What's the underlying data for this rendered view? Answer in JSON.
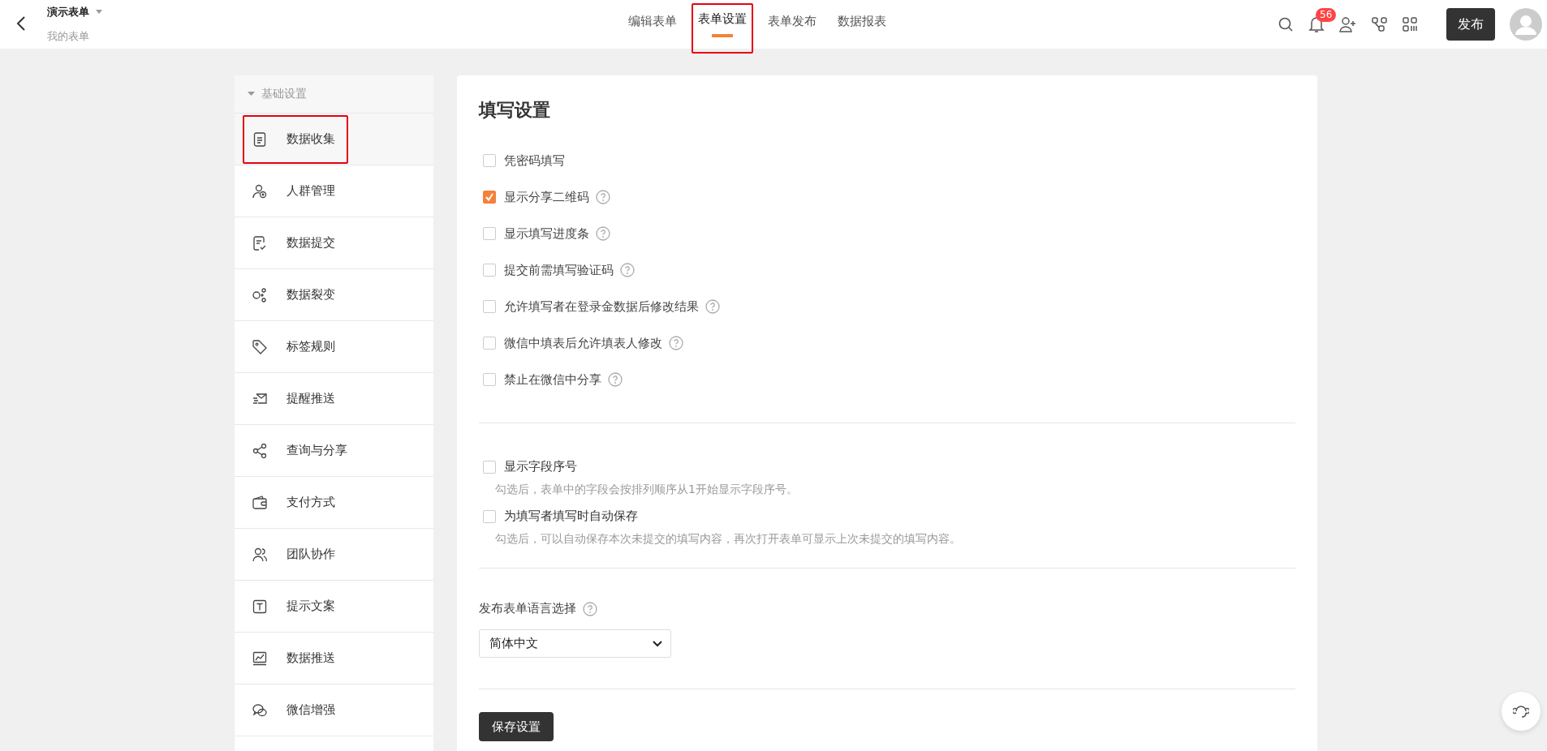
{
  "header": {
    "title": "演示表单",
    "subtitle": "我的表单",
    "notification_count": "56",
    "publish_button": "发布"
  },
  "tabs": [
    {
      "label": "编辑表单",
      "selected": false,
      "annotated": false
    },
    {
      "label": "表单设置",
      "selected": true,
      "annotated": true
    },
    {
      "label": "表单发布",
      "selected": false,
      "annotated": false
    },
    {
      "label": "数据报表",
      "selected": false,
      "annotated": false
    }
  ],
  "sidebar": {
    "section": "基础设置",
    "expanded": true,
    "items": [
      {
        "label": "数据收集",
        "selected": true,
        "annotated": true
      },
      {
        "label": "人群管理",
        "selected": false,
        "annotated": false
      },
      {
        "label": "数据提交",
        "selected": false,
        "annotated": false
      },
      {
        "label": "数据裂变",
        "selected": false,
        "annotated": false
      },
      {
        "label": "标签规则",
        "selected": false,
        "annotated": false
      },
      {
        "label": "提醒推送",
        "selected": false,
        "annotated": false
      },
      {
        "label": "查询与分享",
        "selected": false,
        "annotated": false
      },
      {
        "label": "支付方式",
        "selected": false,
        "annotated": false
      },
      {
        "label": "团队协作",
        "selected": false,
        "annotated": false
      },
      {
        "label": "提示文案",
        "selected": false,
        "annotated": false
      },
      {
        "label": "数据推送",
        "selected": false,
        "annotated": false
      },
      {
        "label": "微信增强",
        "selected": false,
        "annotated": false
      }
    ]
  },
  "panel": {
    "title": "填写设置",
    "options": [
      {
        "label": "凭密码填写",
        "checked": false,
        "help": false
      },
      {
        "label": "显示分享二维码",
        "checked": true,
        "help": true
      },
      {
        "label": "显示填写进度条",
        "checked": false,
        "help": true
      },
      {
        "label": "提交前需填写验证码",
        "checked": false,
        "help": true
      },
      {
        "label": "允许填写者在登录金数据后修改结果",
        "checked": false,
        "help": true
      },
      {
        "label": "微信中填表后允许填表人修改",
        "checked": false,
        "help": true
      },
      {
        "label": "禁止在微信中分享",
        "checked": false,
        "help": true
      }
    ],
    "extra_options": [
      {
        "label": "显示字段序号",
        "checked": false,
        "description": "勾选后，表单中的字段会按排列顺序从1开始显示字段序号。"
      },
      {
        "label": "为填写者填写时自动保存",
        "checked": false,
        "description": "勾选后，可以自动保存本次未提交的填写内容，再次打开表单可显示上次未提交的填写内容。"
      }
    ],
    "language": {
      "label": "发布表单语言选择",
      "value": "简体中文"
    },
    "save_button": "保存设置"
  }
}
